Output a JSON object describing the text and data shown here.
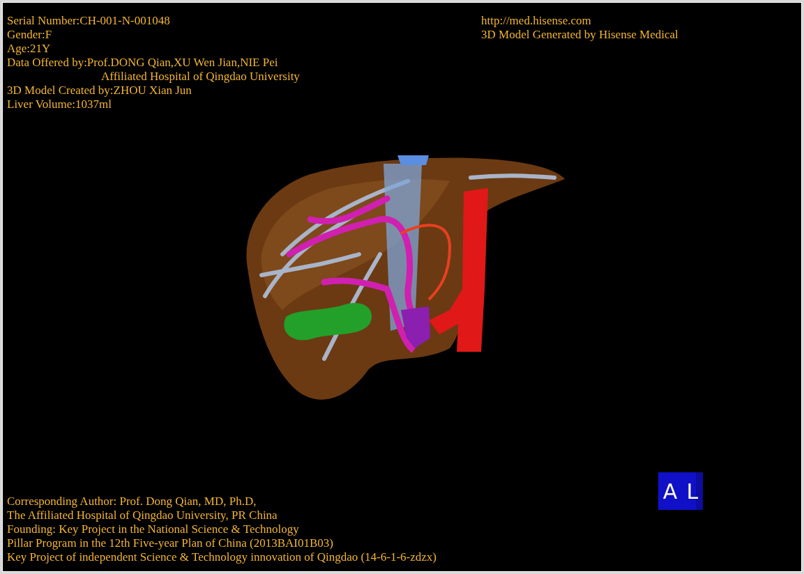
{
  "header_left": [
    {
      "text": "Serial Number:CH-001-N-001048",
      "indented": false
    },
    {
      "text": "Gender:F",
      "indented": false
    },
    {
      "text": "Age:21Y",
      "indented": false
    },
    {
      "text": "Data Offered by:Prof.DONG Qian,XU Wen Jian,NIE Pei",
      "indented": false
    },
    {
      "text": "Affiliated Hospital of Qingdao University",
      "indented": true
    },
    {
      "text": "3D Model Created by:ZHOU Xian Jun",
      "indented": false
    },
    {
      "text": "Liver Volume:1037ml",
      "indented": false
    }
  ],
  "header_right": [
    "http://med.hisense.com",
    "3D Model Generated by Hisense Medical"
  ],
  "footer": [
    "Corresponding Author: Prof. Dong Qian, MD, Ph.D,",
    "The Affiliated Hospital of Qingdao University, PR China",
    "Founding: Key Project in the National Science & Technology",
    "Pillar Program in the 12th Five-year Plan of China (2013BAI01B03)",
    "Key Project of independent Science & Technology innovation of Qingdao (14-6-1-6-zdzx)"
  ],
  "orientation_cube": {
    "front": "A",
    "side": "L"
  }
}
